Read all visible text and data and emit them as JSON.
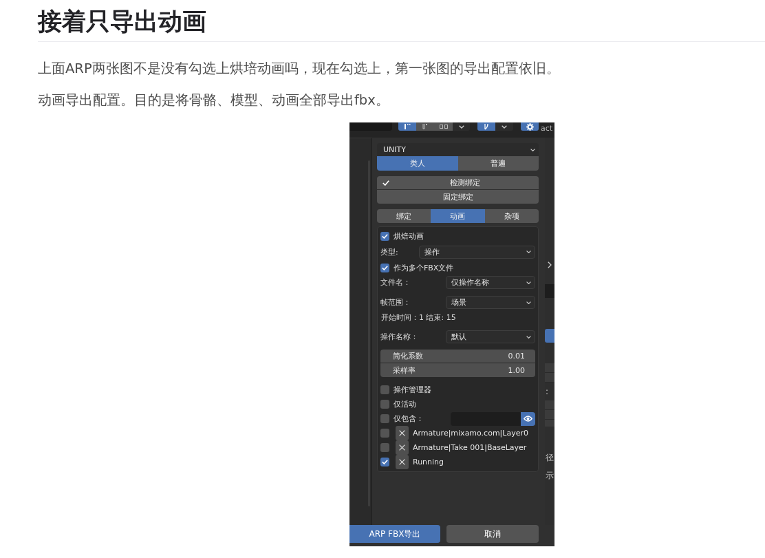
{
  "article": {
    "heading": "接着只导出动画",
    "paragraphs": [
      "上面ARP两张图不是没有勾选上烘培动画吗，现在勾选上，第一张图的导出配置依旧。",
      "动画导出配置。目的是将骨骼、模型、动画全部导出fbx。"
    ]
  },
  "screenshot": {
    "header": {
      "cut_text": "act"
    },
    "preset": {
      "value": "UNITY"
    },
    "rig_type_tabs": [
      {
        "label": "类人",
        "selected": true
      },
      {
        "label": "普遍",
        "selected": false
      }
    ],
    "rig_buttons": [
      {
        "label": "检测绑定",
        "checked": true
      },
      {
        "label": "固定绑定",
        "checked": false
      }
    ],
    "section_tabs": [
      {
        "label": "绑定",
        "selected": false
      },
      {
        "label": "动画",
        "selected": true
      },
      {
        "label": "杂项",
        "selected": false
      }
    ],
    "animation": {
      "bake_animation": {
        "label": "烘焙动画",
        "checked": true
      },
      "type_field": {
        "label": "类型:",
        "value": "操作"
      },
      "multiple_fbx": {
        "label": "作为多个FBX文件",
        "checked": true
      },
      "fields": [
        {
          "kind": "dropdown",
          "label": "文件名：",
          "value": "仅操作名称"
        },
        {
          "kind": "dropdown",
          "label": "帧范围：",
          "value": "场景"
        },
        {
          "kind": "info",
          "text": "开始时间：1 结束: 15"
        },
        {
          "kind": "dropdown",
          "label": "操作名称：",
          "value": "默认"
        }
      ],
      "numbers": [
        {
          "label": "简化系数",
          "value": "0.01"
        },
        {
          "label": "采样率",
          "value": "1.00"
        }
      ],
      "options": [
        {
          "label": "操作管理器",
          "checked": false
        },
        {
          "label": "仅活动",
          "checked": false
        }
      ],
      "include_only": {
        "label": "仅包含：",
        "checked": false,
        "filter_on": true
      },
      "actions": [
        {
          "name": "Armature|mixamo.com|Layer0",
          "checked": false
        },
        {
          "name": "Armature|Take 001|BaseLayer",
          "checked": false
        },
        {
          "name": "Running",
          "checked": true
        }
      ]
    },
    "buttons": [
      {
        "label": "ARP FBX导出",
        "kind": "primary"
      },
      {
        "label": "取消",
        "kind": "secondary"
      }
    ],
    "side_strip": {
      "texts": [
        ":",
        "径",
        "示"
      ]
    }
  }
}
